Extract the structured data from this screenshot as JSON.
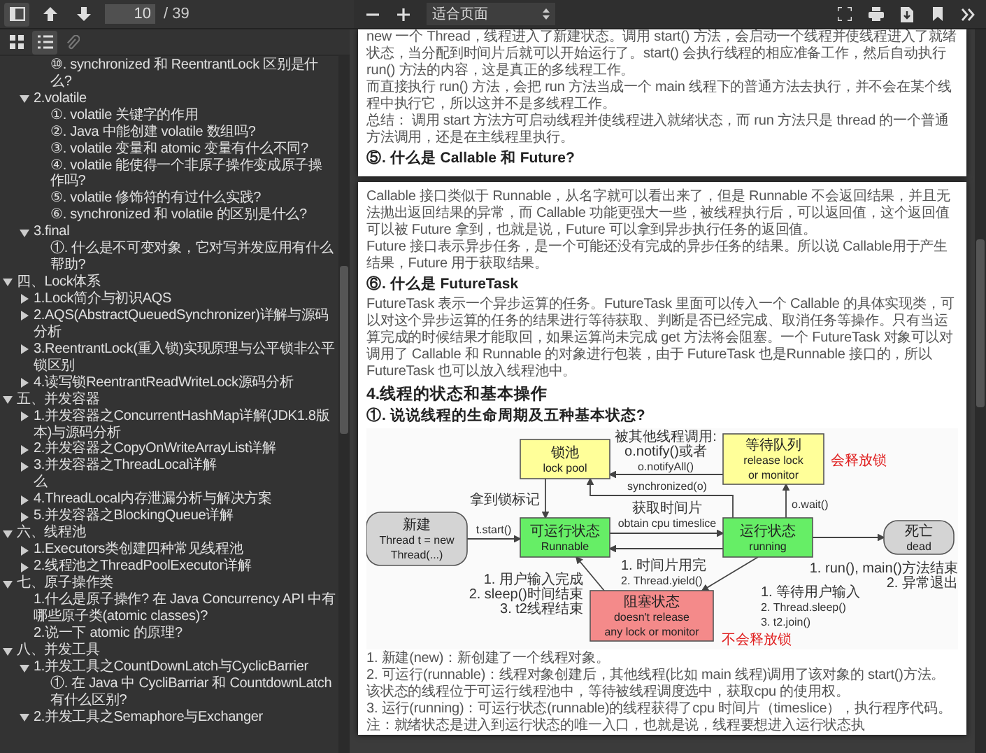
{
  "toolbar": {
    "page_number": "10",
    "page_total": "/ 39",
    "zoom": "适合页面"
  },
  "sidebar": {
    "tabs": [
      {
        "kind": "thumbnails",
        "selected": false
      },
      {
        "kind": "outline",
        "selected": true
      },
      {
        "kind": "attachments",
        "selected": false
      }
    ],
    "outline": [
      {
        "children": [
          {
            "children": [
              {
                "label": "⑩. synchronized 和 ReentrantLock 区别是什么?"
              }
            ]
          },
          {
            "label": "2.volatile",
            "expanded": true,
            "children": [
              {
                "label": "①. volatile 关键字的作用"
              },
              {
                "label": "②. Java 中能创建 volatile 数组吗?"
              },
              {
                "label": "③. volatile 变量和 atomic 变量有什么不同?"
              },
              {
                "label": "④. volatile 能使得一个非原子操作变成原子操作吗?"
              },
              {
                "label": "⑤. volatile 修饰符的有过什么实践?"
              },
              {
                "label": "⑥. synchronized 和 volatile 的区别是什么?"
              }
            ]
          },
          {
            "label": "3.final",
            "expanded": true,
            "children": [
              {
                "label": "①. 什么是不可变对象，它对写并发应用有什么帮助?"
              }
            ]
          }
        ]
      },
      {
        "label": "四、Lock体系",
        "expanded": true,
        "children": [
          {
            "label": "1.Lock简介与初识AQS",
            "expanded": false
          },
          {
            "label": "2.AQS(AbstractQueuedSynchronizer)详解与源码分析",
            "expanded": false
          },
          {
            "label": "3.ReentrantLock(重入锁)实现原理与公平锁非公平锁区别",
            "expanded": false
          },
          {
            "label": "4.读写锁ReentrantReadWriteLock源码分析",
            "expanded": false
          }
        ]
      },
      {
        "label": "五、并发容器",
        "expanded": true,
        "children": [
          {
            "label": "1.并发容器之ConcurrentHashMap详解(JDK1.8版本)与源码分析",
            "expanded": false
          },
          {
            "label": "2.并发容器之CopyOnWriteArrayList详解",
            "expanded": false
          },
          {
            "label": "3.并发容器之ThreadLocal详解",
            "expanded": false
          },
          {
            "label": "么"
          },
          {
            "label": "4.ThreadLocal内存泄漏分析与解决方案",
            "expanded": false
          },
          {
            "label": "5.并发容器之BlockingQueue详解",
            "expanded": false
          }
        ]
      },
      {
        "label": "六、线程池",
        "expanded": true,
        "children": [
          {
            "label": "1.Executors类创建四种常见线程池",
            "expanded": false
          },
          {
            "label": "2.线程池之ThreadPoolExecutor详解",
            "expanded": false
          }
        ]
      },
      {
        "label": "七、原子操作类",
        "expanded": true,
        "children": [
          {
            "label": "1.什么是原子操作? 在 Java Concurrency API 中有哪些原子类(atomic classes)?"
          },
          {
            "label": "2.说一下 atomic 的原理?"
          }
        ]
      },
      {
        "label": "八、并发工具",
        "expanded": true,
        "children": [
          {
            "label": "1.并发工具之CountDownLatch与CyclicBarrier",
            "expanded": true,
            "children": [
              {
                "label": "①. 在 Java 中 CycliBarriar 和 CountdownLatch 有什么区别?"
              }
            ]
          },
          {
            "label": "2.并发工具之Semaphore与Exchanger",
            "expanded": true
          }
        ]
      }
    ]
  },
  "pages": [
    {
      "blocks": [
        {
          "kind": "paragraph",
          "text": "new 一个 Thread，线程进入了新建状态。调用 start() 方法，会启动一个线程并使线程进入了就绪状态，当分配到时间片后就可以开始运行了。start() 会执行线程的相应准备工作，然后自动执行 run() 方法的内容，这是真正的多线程工作。"
        },
        {
          "kind": "paragraph",
          "text": "而直接执行 run() 方法，会把 run 方法当成一个 main 线程下的普通方法去执行，并不会在某个线程中执行它，所以这并不是多线程工作。"
        },
        {
          "kind": "paragraph",
          "text": "总结： 调用 start 方法方可启动线程并使线程进入就绪状态，而 run 方法只是 thread 的一个普通方法调用，还是在主线程里执行。"
        },
        {
          "kind": "heading",
          "text": "⑤. 什么是 Callable 和 Future?"
        }
      ]
    },
    {
      "blocks": [
        {
          "kind": "paragraph",
          "text": "Callable 接口类似于 Runnable，从名字就可以看出来了，但是 Runnable 不会返回结果，并且无法抛出返回结果的异常，而 Callable 功能更强大一些，被线程执行后，可以返回值，这个返回值可以被 Future 拿到，也就是说，Future 可以拿到异步执行任务的返回值。"
        },
        {
          "kind": "paragraph",
          "text": "Future 接口表示异步任务，是一个可能还没有完成的异步任务的结果。所以说 Callable用于产生结果，Future 用于获取结果。"
        },
        {
          "kind": "heading",
          "text": "⑥. 什么是 FutureTask"
        },
        {
          "kind": "paragraph",
          "text": "FutureTask 表示一个异步运算的任务。FutureTask 里面可以传入一个 Callable 的具体实现类，可以对这个异步运算的任务的结果进行等待获取、判断是否已经完成、取消任务等操作。只有当运算完成的时候结果才能取回，如果运算尚未完成 get 方法将会阻塞。一个 FutureTask 对象可以对调用了 Callable 和 Runnable 的对象进行包装，由于 FutureTask 也是Runnable 接口的，所以 FutureTask 也可以放入线程池中。"
        },
        {
          "kind": "section",
          "text": "4.线程的状态和基本操作"
        },
        {
          "kind": "heading",
          "text": "①. 说说线程的生命周期及五种基本状态?"
        },
        {
          "kind": "figure",
          "nodes": [
            {
              "kind": "terminal",
              "color": "#d4d4d4",
              "lines": [
                "新建",
                "Thread t = new",
                "Thread(...)"
              ]
            },
            {
              "kind": "state",
              "color": "#ffff99",
              "lines": [
                "锁池",
                "lock pool"
              ]
            },
            {
              "kind": "state",
              "color": "#ffff99",
              "lines": [
                "等待队列",
                "release lock",
                "or monitor"
              ]
            },
            {
              "kind": "state",
              "color": "#66ee66",
              "lines": [
                "可运行状态",
                "Runnable"
              ]
            },
            {
              "kind": "state",
              "color": "#66ee66",
              "lines": [
                "运行状态",
                "running"
              ]
            },
            {
              "kind": "terminal",
              "color": "#d4d4d4",
              "lines": [
                "死亡",
                "dead"
              ]
            },
            {
              "kind": "state",
              "color": "#f48a8a",
              "lines": [
                "阻塞状态",
                "doesn't release",
                "any lock or monitor"
              ]
            }
          ],
          "labels": [
            {
              "color": "#333333",
              "lines": [
                "被其他线程调用:",
                "o.notify()或者",
                "o.notifyAll()"
              ]
            },
            {
              "color": "#e02020",
              "lines": [
                "会释放锁"
              ]
            },
            {
              "color": "#333333",
              "lines": [
                "synchronized(o)"
              ]
            },
            {
              "color": "#333333",
              "lines": [
                "拿到锁标记"
              ]
            },
            {
              "color": "#333333",
              "lines": [
                "获取时间片",
                "obtain cpu timeslice"
              ]
            },
            {
              "color": "#333333",
              "lines": [
                "o.wait()"
              ]
            },
            {
              "color": "#333333",
              "lines": [
                "t.start()"
              ]
            },
            {
              "color": "#333333",
              "lines": [
                "1. 时间片用完",
                "2. Thread.yield()"
              ]
            },
            {
              "color": "#333333",
              "lines": [
                "1. run(), main()方法结束",
                "2. 异常退出"
              ]
            },
            {
              "color": "#333333",
              "lines": [
                "1. 用户输入完成",
                "2. sleep()时间结束",
                "3. t2线程结束"
              ]
            },
            {
              "color": "#333333",
              "lines": [
                "1. 等待用户输入",
                "2. Thread.sleep()",
                "3. t2.join()"
              ]
            },
            {
              "color": "#e02020",
              "lines": [
                "不会释放锁"
              ]
            }
          ]
        },
        {
          "kind": "list",
          "items": [
            "1. 新建(new)：新创建了一个线程对象。",
            "2. 可运行(runnable)：线程对象创建后，其他线程(比如 main 线程)调用了该对象的 start()方法。该状态的线程位于可运行线程池中，等待被线程调度选中，获取cpu 的使用权。",
            "3. 运行(running)：可运行状态(runnable)的线程获得了cpu 时间片（timeslice），执行程序代码。注：就绪状态是进入到运行状态的唯一入口，也就是说，线程要想进入运行状态执"
          ]
        }
      ]
    }
  ]
}
